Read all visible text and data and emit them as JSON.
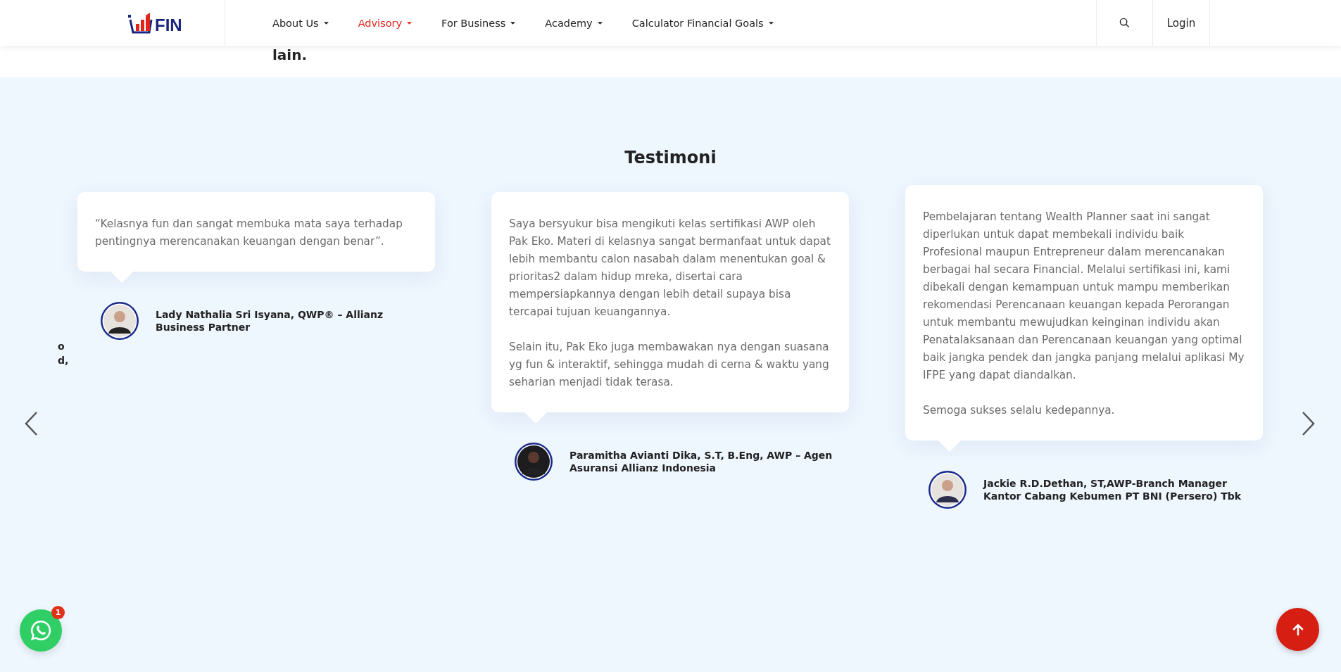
{
  "header": {
    "logo_text": "FIN",
    "nav": [
      {
        "label": "About Us",
        "selected": false
      },
      {
        "label": "Advisory",
        "selected": true
      },
      {
        "label": "For Business",
        "selected": false
      },
      {
        "label": "Academy",
        "selected": false
      },
      {
        "label": "Calculator Financial Goals",
        "selected": false
      }
    ],
    "login": "Login"
  },
  "previous_section_text": "lain.",
  "testimonials": {
    "title": "Testimoni",
    "peek_lines": [
      "o",
      "d,"
    ],
    "items": [
      {
        "paragraphs": [
          "“Kelasnya fun dan sangat membuka mata saya terhadap pentingnya merencanakan keuangan dengan benar”."
        ],
        "author": "Lady Nathalia Sri Isyana, QWP® – Allianz Business Partner"
      },
      {
        "paragraphs": [
          "Saya bersyukur bisa mengikuti kelas sertifikasi AWP oleh Pak Eko. Materi di kelasnya sangat bermanfaat untuk dapat lebih membantu calon nasabah dalam menentukan goal & prioritas2 dalam hidup mreka, disertai cara mempersiapkannya dengan lebih detail supaya bisa tercapai tujuan keuangannya.",
          "Selain itu, Pak Eko juga membawakan nya dengan suasana yg fun & interaktif, sehingga mudah di cerna & waktu yang seharian menjadi tidak terasa."
        ],
        "author": "Paramitha Avianti Dika, S.T, B.Eng, AWP – Agen Asuransi Allianz Indonesia"
      },
      {
        "paragraphs": [
          "Pembelajaran tentang Wealth Planner saat ini sangat diperlukan untuk dapat membekali individu baik Profesional maupun Entrepreneur dalam merencanakan berbagai hal secara Financial. Melalui sertifikasi ini, kami dibekali dengan kemampuan untuk mampu memberikan rekomendasi Perencanaan keuangan kepada Perorangan untuk membantu mewujudkan keinginan individu akan Penatalaksanaan dan Perencanaan keuangan yang optimal baik jangka pendek dan jangka panjang melalui aplikasi My IFPE yang dapat diandalkan.",
          "Semoga sukses selalu kedepannya."
        ],
        "author": "Jackie R.D.Dethan, ST,AWP-Branch Manager Kantor Cabang Kebumen PT BNI (Persero) Tbk"
      }
    ]
  },
  "chat_badge": "1"
}
